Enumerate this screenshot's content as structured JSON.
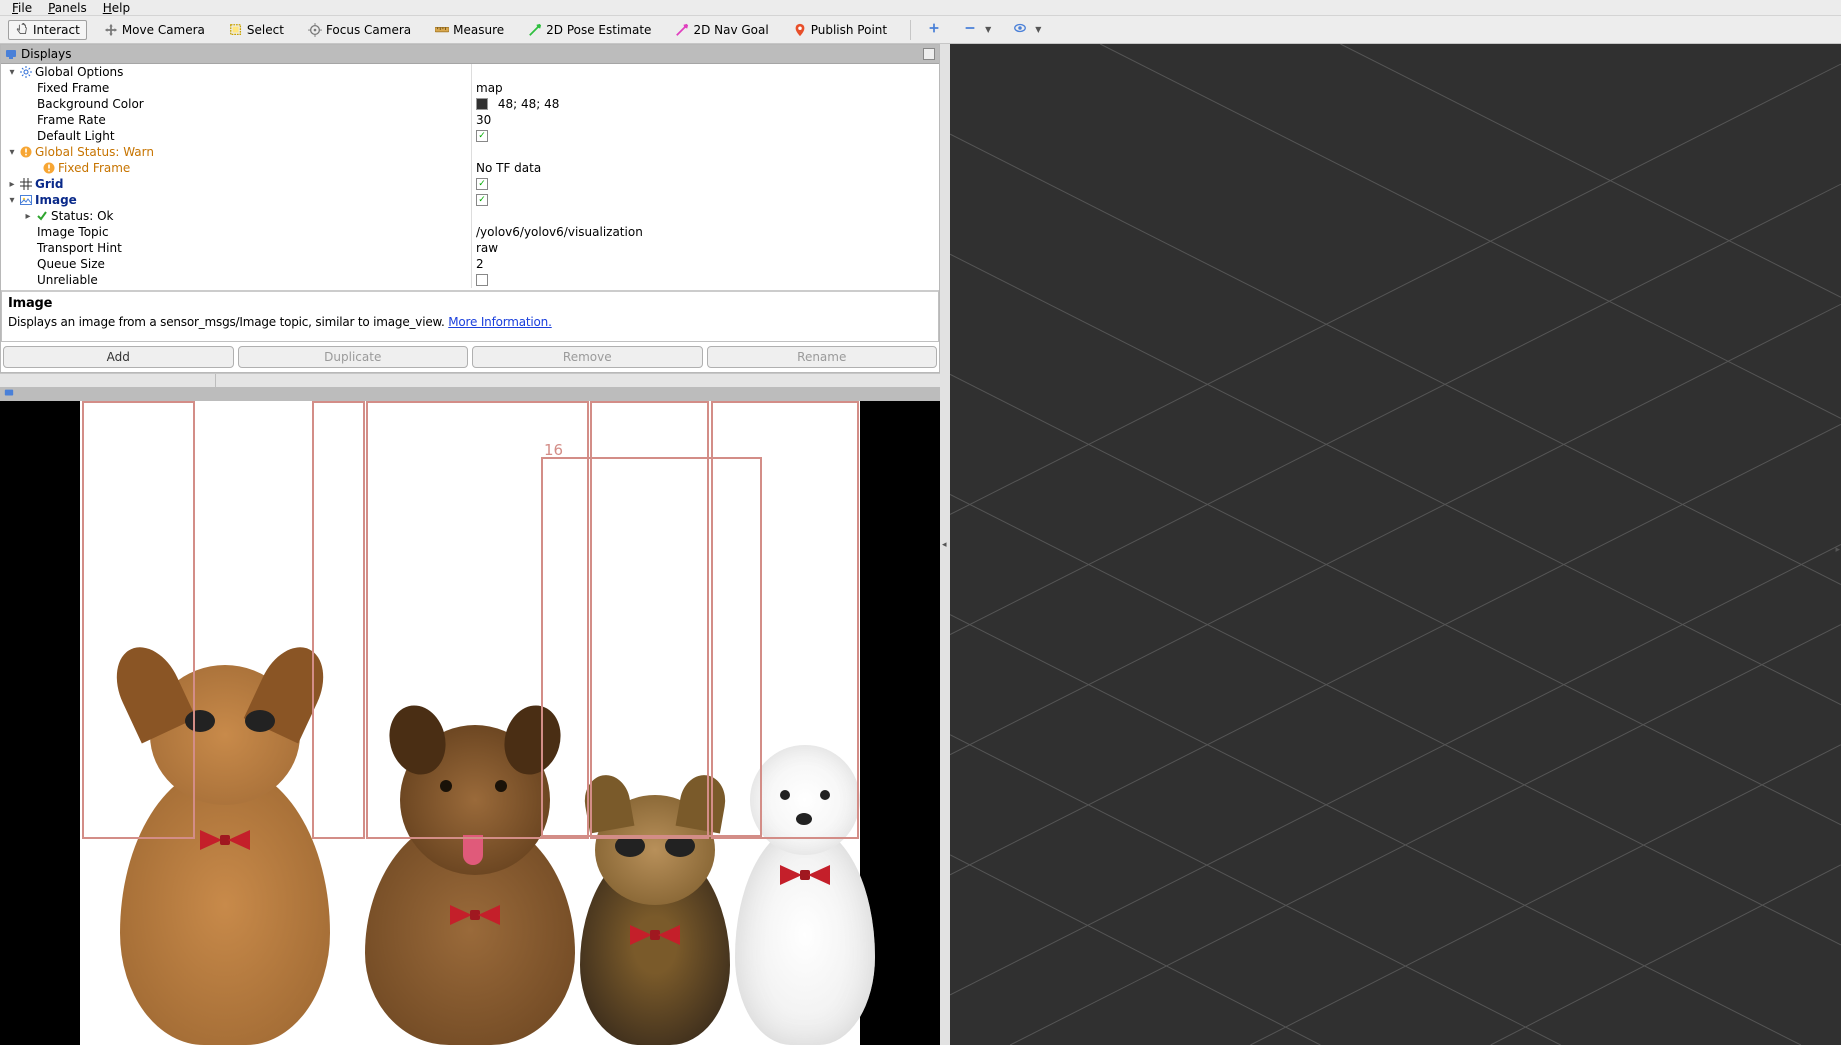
{
  "menu": {
    "file": "File",
    "panels": "Panels",
    "help": "Help"
  },
  "toolbar": {
    "interact": "Interact",
    "move_camera": "Move Camera",
    "select": "Select",
    "focus_camera": "Focus Camera",
    "measure": "Measure",
    "pose_estimate": "2D Pose Estimate",
    "nav_goal": "2D Nav Goal",
    "publish_point": "Publish Point"
  },
  "displays": {
    "title": "Displays",
    "global_options": {
      "label": "Global Options",
      "fixed_frame": {
        "label": "Fixed Frame",
        "value": "map"
      },
      "bg_color": {
        "label": "Background Color",
        "value": "48; 48; 48"
      },
      "frame_rate": {
        "label": "Frame Rate",
        "value": "30"
      },
      "default_light": {
        "label": "Default Light",
        "checked": true
      }
    },
    "global_status": {
      "label": "Global Status: Warn",
      "fixed_frame": {
        "label": "Fixed Frame",
        "value": "No TF data"
      }
    },
    "grid": {
      "label": "Grid",
      "checked": true
    },
    "image": {
      "label": "Image",
      "checked": true,
      "status": {
        "label": "Status: Ok"
      },
      "topic": {
        "label": "Image Topic",
        "value": "/yolov6/yolov6/visualization"
      },
      "transport": {
        "label": "Transport Hint",
        "value": "raw"
      },
      "queue": {
        "label": "Queue Size",
        "value": "2"
      },
      "unreliable": {
        "label": "Unreliable",
        "checked": false
      }
    }
  },
  "description": {
    "title": "Image",
    "body_prefix": "Displays an image from a sensor_msgs/Image topic, similar to image_view. ",
    "link": "More Information."
  },
  "buttons": {
    "add": "Add",
    "duplicate": "Duplicate",
    "remove": "Remove",
    "rename": "Rename"
  },
  "detection": {
    "label_16": "16"
  }
}
